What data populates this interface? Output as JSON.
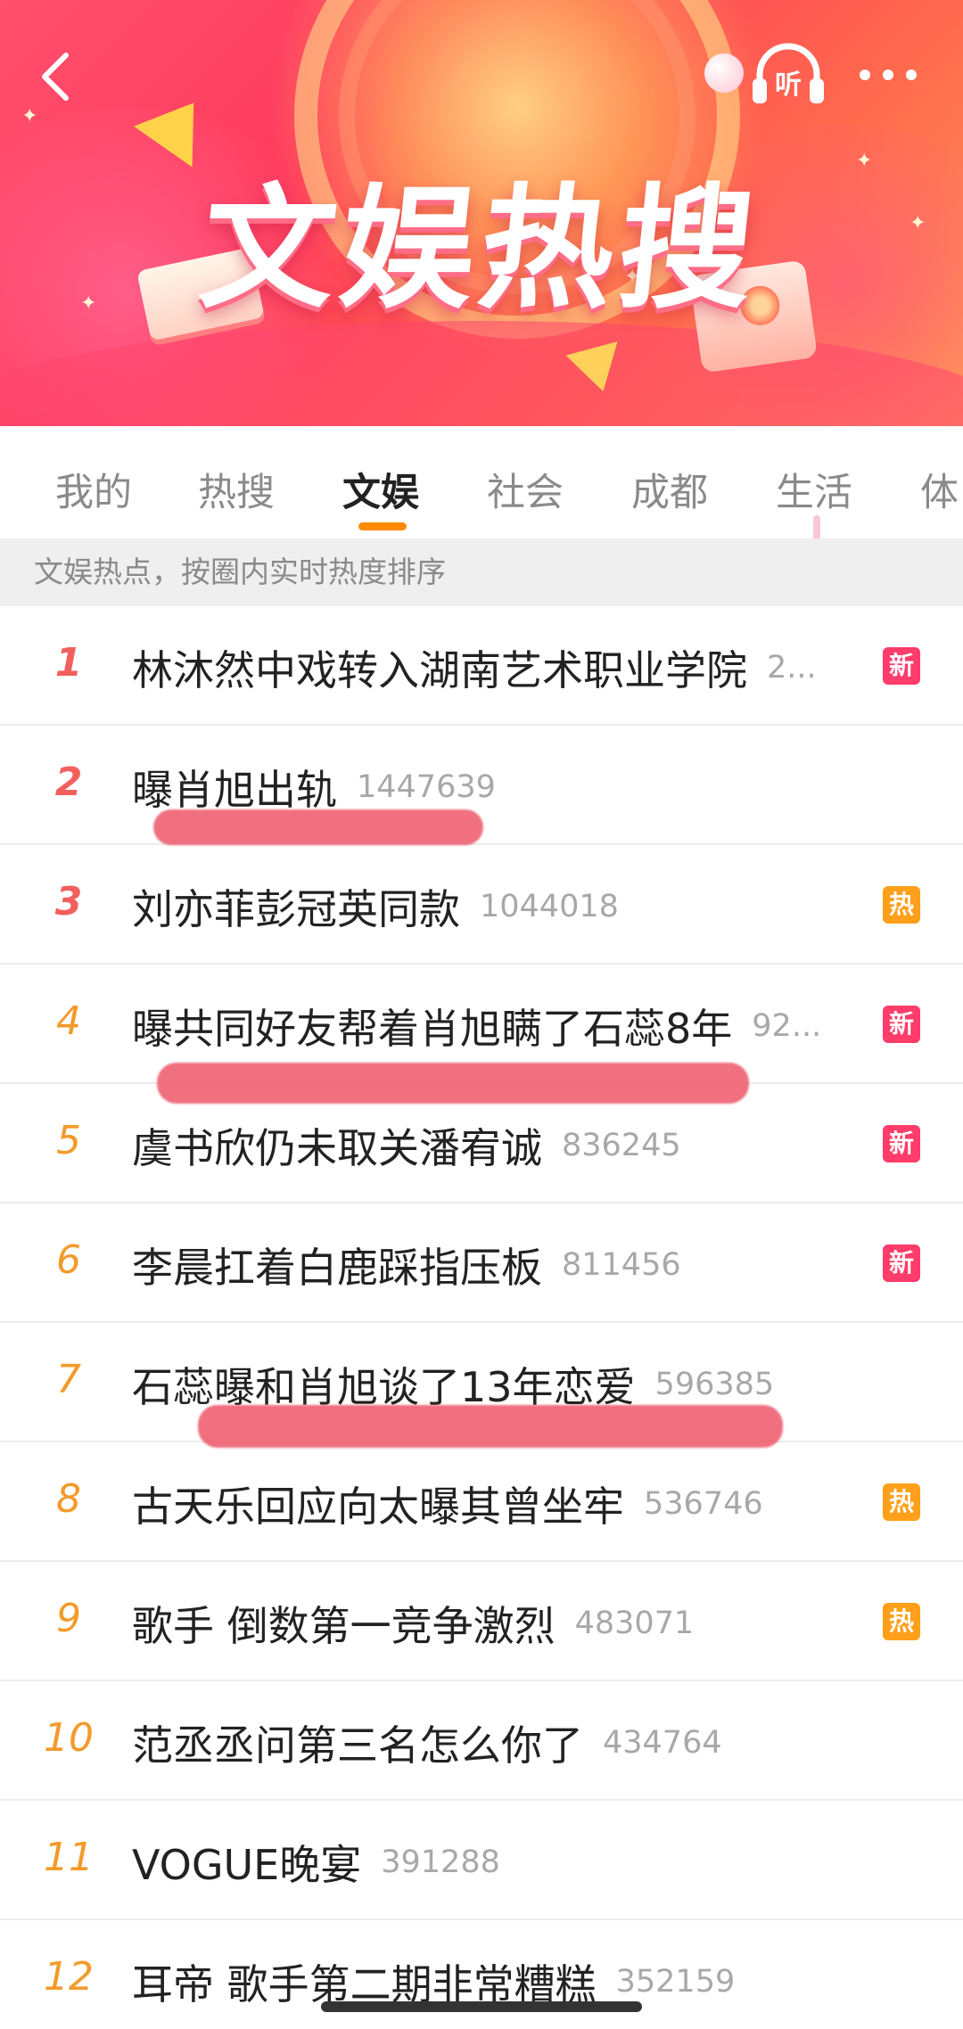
{
  "banner": {
    "title": "文娱热搜",
    "listen_label": "听"
  },
  "tabs": [
    {
      "label": "我的"
    },
    {
      "label": "热搜"
    },
    {
      "label": "文娱"
    },
    {
      "label": "社会"
    },
    {
      "label": "成都"
    },
    {
      "label": "生活"
    },
    {
      "label": "体"
    }
  ],
  "active_tab": "文娱",
  "subheader": "文娱热点，按圈内实时热度排序",
  "items": [
    {
      "rank": "1",
      "title": "林沐然中戏转入湖南艺术职业学院",
      "heat": "2...",
      "badge": "新"
    },
    {
      "rank": "2",
      "title": "曝肖旭出轨",
      "heat": "1447639",
      "badge": ""
    },
    {
      "rank": "3",
      "title": "刘亦菲彭冠英同款",
      "heat": "1044018",
      "badge": "热"
    },
    {
      "rank": "4",
      "title": "曝共同好友帮着肖旭瞒了石蕊8年",
      "heat": "92...",
      "badge": "新"
    },
    {
      "rank": "5",
      "title": "虞书欣仍未取关潘宥诚",
      "heat": "836245",
      "badge": "新"
    },
    {
      "rank": "6",
      "title": "李晨扛着白鹿踩指压板",
      "heat": "811456",
      "badge": "新"
    },
    {
      "rank": "7",
      "title": "石蕊曝和肖旭谈了13年恋爱",
      "heat": "596385",
      "badge": ""
    },
    {
      "rank": "8",
      "title": "古天乐回应向太曝其曾坐牢",
      "heat": "536746",
      "badge": "热"
    },
    {
      "rank": "9",
      "title": "歌手 倒数第一竞争激烈",
      "heat": "483071",
      "badge": "热"
    },
    {
      "rank": "10",
      "title": "范丞丞问第三名怎么你了",
      "heat": "434764",
      "badge": ""
    },
    {
      "rank": "11",
      "title": "VOGUE晚宴",
      "heat": "391288",
      "badge": ""
    },
    {
      "rank": "12",
      "title": "耳帝 歌手第二期非常糟糕",
      "heat": "352159",
      "badge": ""
    }
  ],
  "colors": {
    "rank_top": "#f2605e",
    "rank_mid": "#f49a2a",
    "badge_new": "#ff3c6a",
    "badge_hot": "#ff9f1a",
    "tab_indicator": "#ff8a00"
  }
}
